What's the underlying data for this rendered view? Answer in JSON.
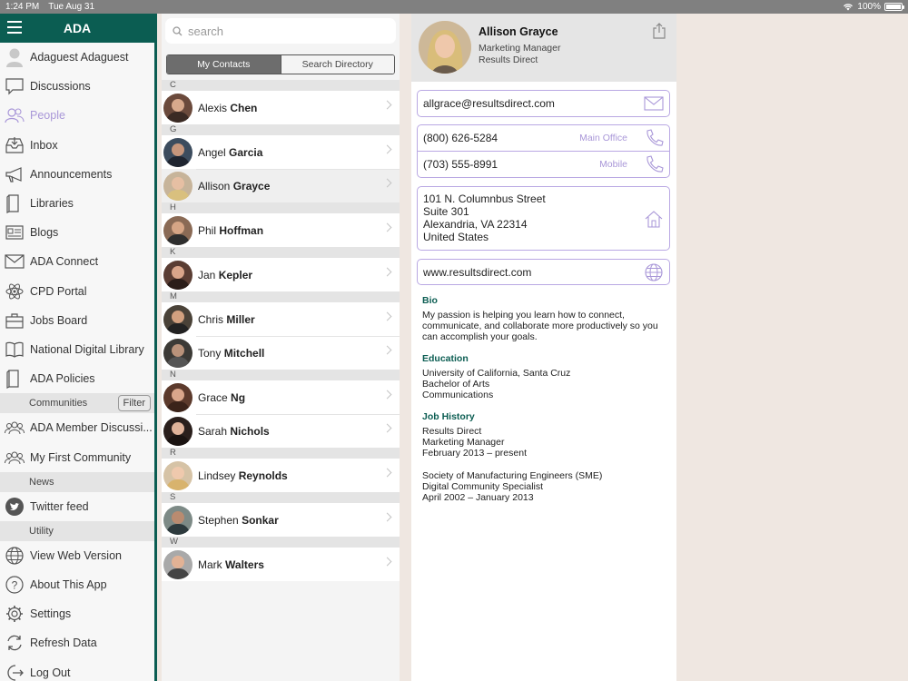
{
  "status": {
    "time": "1:24 PM",
    "date": "Tue Aug 31",
    "battery": "100%"
  },
  "sidebar": {
    "title": "ADA",
    "items": [
      {
        "label": "Adaguest Adaguest",
        "icon": "user-icon"
      },
      {
        "label": "Discussions",
        "icon": "chat-bubble-icon"
      },
      {
        "label": "People",
        "icon": "people-icon"
      },
      {
        "label": "Inbox",
        "icon": "inbox-icon"
      },
      {
        "label": "Announcements",
        "icon": "megaphone-icon"
      },
      {
        "label": "Libraries",
        "icon": "book-icon"
      },
      {
        "label": "Blogs",
        "icon": "blog-icon"
      },
      {
        "label": "ADA Connect",
        "icon": "envelope-icon"
      },
      {
        "label": "CPD Portal",
        "icon": "atom-icon"
      },
      {
        "label": "Jobs Board",
        "icon": "briefcase-icon"
      },
      {
        "label": "National Digital Library",
        "icon": "open-book-icon"
      },
      {
        "label": "ADA Policies",
        "icon": "book-icon"
      }
    ],
    "communities_section": "Communities",
    "filter_label": "Filter",
    "community_items": [
      {
        "label": "ADA Member Discussi...",
        "icon": "group-icon"
      },
      {
        "label": "My First Community",
        "icon": "group-icon"
      }
    ],
    "news_section": "News",
    "news_items": [
      {
        "label": "Twitter feed",
        "icon": "twitter-icon"
      }
    ],
    "utility_section": "Utility",
    "utility_items": [
      {
        "label": "View Web Version",
        "icon": "globe-icon"
      },
      {
        "label": "About This App",
        "icon": "question-icon"
      },
      {
        "label": "Settings",
        "icon": "gear-icon"
      },
      {
        "label": "Refresh Data",
        "icon": "refresh-icon"
      },
      {
        "label": "Log Out",
        "icon": "logout-icon"
      }
    ],
    "active_color": "#a997d8",
    "brand_color": "#0b5d52"
  },
  "contacts": {
    "search_placeholder": "search",
    "seg_my": "My Contacts",
    "seg_dir": "Search Directory",
    "groups": [
      {
        "letter": "C",
        "people": [
          {
            "first": "Alexis",
            "last": "Chen"
          }
        ]
      },
      {
        "letter": "G",
        "people": [
          {
            "first": "Angel",
            "last": "Garcia"
          },
          {
            "first": "Allison",
            "last": "Grayce"
          }
        ]
      },
      {
        "letter": "H",
        "people": [
          {
            "first": "Phil",
            "last": "Hoffman"
          }
        ]
      },
      {
        "letter": "K",
        "people": [
          {
            "first": "Jan",
            "last": "Kepler"
          }
        ]
      },
      {
        "letter": "M",
        "people": [
          {
            "first": "Chris",
            "last": "Miller"
          },
          {
            "first": "Tony",
            "last": "Mitchell"
          }
        ]
      },
      {
        "letter": "N",
        "people": [
          {
            "first": "Grace",
            "last": "Ng"
          },
          {
            "first": "Sarah",
            "last": "Nichols"
          }
        ]
      },
      {
        "letter": "R",
        "people": [
          {
            "first": "Lindsey",
            "last": "Reynolds"
          }
        ]
      },
      {
        "letter": "S",
        "people": [
          {
            "first": "Stephen",
            "last": "Sonkar"
          }
        ]
      },
      {
        "letter": "W",
        "people": [
          {
            "first": "Mark",
            "last": "Walters"
          }
        ]
      }
    ]
  },
  "detail": {
    "name": "Allison Grayce",
    "title": "Marketing Manager",
    "company": "Results Direct",
    "email": "allgrace@resultsdirect.com",
    "phone_main": "(800) 626-5284",
    "phone_main_label": "Main Office",
    "phone_mobile": "(703) 555-8991",
    "phone_mobile_label": "Mobile",
    "address": [
      "101 N. Columnbus Street",
      "Suite 301",
      "Alexandria, VA 22314",
      "United States"
    ],
    "website": "www.resultsdirect.com",
    "bio_head": "Bio",
    "bio": "My passion is helping you learn how to connect, communicate, and collaborate more productively so you can accomplish your goals.",
    "edu_head": "Education",
    "edu": [
      "University of California, Santa Cruz",
      "Bachelor of Arts",
      "Communications"
    ],
    "job_head": "Job History",
    "job1": [
      "Results Direct",
      "Marketing Manager",
      "February 2013 – present"
    ],
    "job2": [
      "Society of Manufacturing Engineers (SME)",
      "Digital Community Specialist",
      "April 2002 – January 2013"
    ]
  }
}
